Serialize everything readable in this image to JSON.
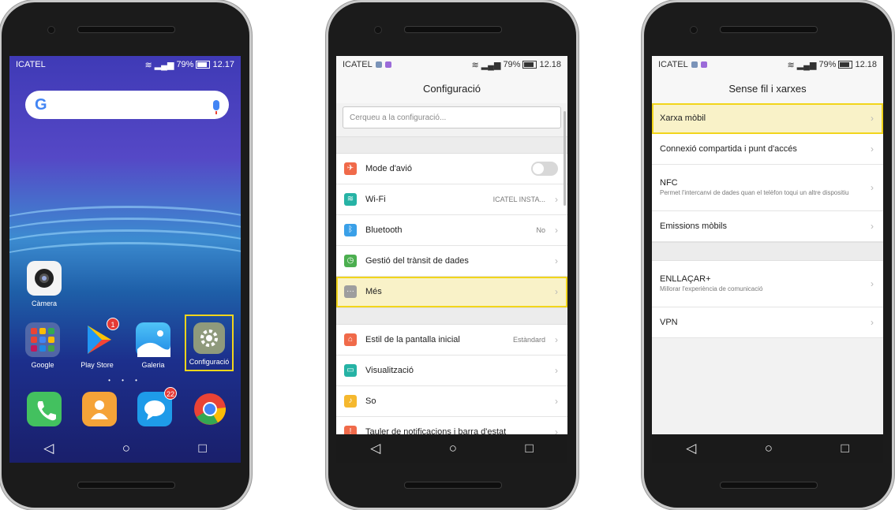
{
  "phones": {
    "home": {
      "status": {
        "carrier": "ICATEL",
        "signal": "79%",
        "time": "12.17"
      },
      "search_g": "G",
      "apps": {
        "camera": "Càmera",
        "google": "Google",
        "play_store": "Play Store",
        "play_badge": "1",
        "gallery": "Galeria",
        "settings": "Configuració",
        "messages_badge": "22"
      },
      "page_dots": "• • •",
      "nav": {
        "back": "◁",
        "home": "○",
        "recents": "□"
      }
    },
    "settings": {
      "status": {
        "carrier": "ICATEL",
        "signal": "79%",
        "time": "12.18"
      },
      "title": "Configuració",
      "search_placeholder": "Cerqueu a la configuració...",
      "items": [
        {
          "label": "Mode d'avió",
          "color": "#f06a4a"
        },
        {
          "label": "Wi-Fi",
          "value": "ICATEL INSTA...",
          "color": "#26b3a5"
        },
        {
          "label": "Bluetooth",
          "value": "No",
          "color": "#3aa0e8"
        },
        {
          "label": "Gestió del trànsit de dades",
          "color": "#4caf50"
        },
        {
          "label": "Més",
          "color": "#9e9e9e"
        },
        {
          "label": "Estil de la pantalla inicial",
          "value": "Estàndard",
          "color": "#f06a4a"
        },
        {
          "label": "Visualització",
          "color": "#26b3a5"
        },
        {
          "label": "So",
          "color": "#f5b82e"
        },
        {
          "label": "Tauler de notificacions i barra d'estat",
          "color": "#f06a4a"
        }
      ],
      "nav": {
        "back": "◁",
        "home": "○",
        "recents": "□"
      }
    },
    "network": {
      "status": {
        "carrier": "ICATEL",
        "signal": "79%",
        "time": "12.18"
      },
      "title": "Sense fil i xarxes",
      "items": [
        {
          "label": "Xarxa mòbil"
        },
        {
          "label": "Connexió compartida i punt d'accés"
        },
        {
          "label": "NFC",
          "sub": "Permet l'intercanvi de dades quan el telèfon toqui un altre dispositiu"
        },
        {
          "label": "Emissions mòbils"
        },
        {
          "label": "ENLLAÇAR+",
          "sub": "Millorar l'experiència de comunicació"
        },
        {
          "label": "VPN"
        }
      ],
      "nav": {
        "back": "◁",
        "home": "○",
        "recents": "□"
      }
    }
  },
  "colors": {
    "highlight": "#f2d51b",
    "highlight_fill": "#f9f2c8"
  }
}
